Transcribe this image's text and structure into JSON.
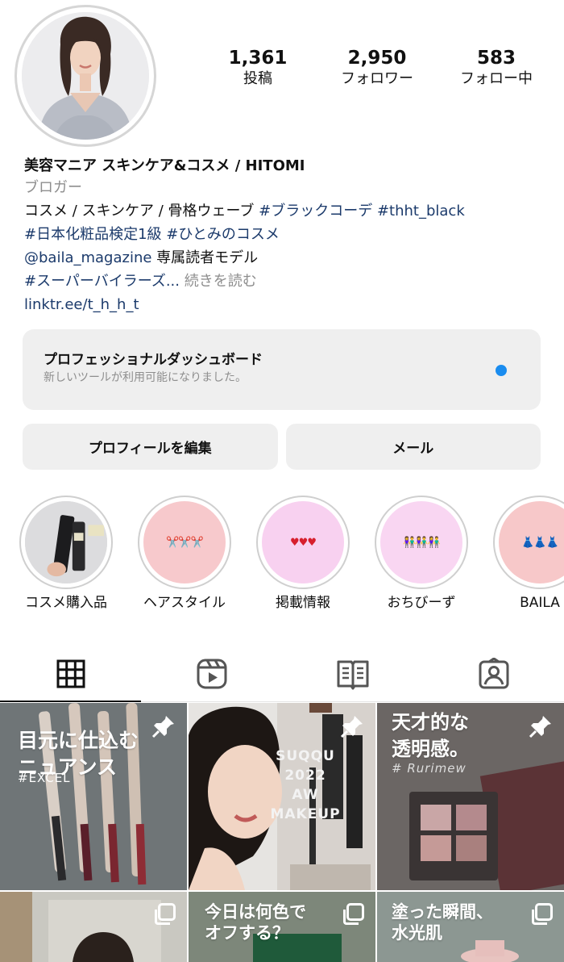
{
  "profile": {
    "stats": [
      {
        "value": "1,361",
        "label": "投稿"
      },
      {
        "value": "2,950",
        "label": "フォロワー"
      },
      {
        "value": "583",
        "label": "フォロー中"
      }
    ],
    "name": "美容マニア スキンケア&コスメ / HITOMI",
    "category": "ブロガー",
    "bio": {
      "line1_text": "コスメ / スキンケア / 骨格ウェーブ ",
      "line1_tag1": "#ブラックコーデ",
      "line1_tag2": "#thht_black",
      "line2_tag1": "#日本化粧品検定1級",
      "line2_tag2": "#ひとみのコスメ",
      "line3_mention": "@baila_magazine",
      "line3_text": " 専属読者モデル",
      "line4_tag": "#スーパーバイラーズ...",
      "line4_more": "続きを読む",
      "link": "linktr.ee/t_h_h_t"
    }
  },
  "dashboard": {
    "title": "プロフェッショナルダッシュボード",
    "subtitle": "新しいツールが利用可能になりました。",
    "dot_color": "#1a8cef"
  },
  "buttons": {
    "edit_profile": "プロフィールを編集",
    "email": "メール"
  },
  "highlights": [
    {
      "label": "コスメ購入品",
      "icon": "cosmetics-photo"
    },
    {
      "label": "ヘアスタイル",
      "icon": "scissors-emoji"
    },
    {
      "label": "掲載情報",
      "icon": "hearts-emoji"
    },
    {
      "label": "おちびーず",
      "icon": "people-emoji"
    },
    {
      "label": "BAILA",
      "icon": "dress-emoji"
    }
  ],
  "tabs": [
    "grid-icon",
    "reels-icon",
    "guides-icon",
    "tagged-icon"
  ],
  "posts": [
    {
      "text": "目元に仕込む\nニュアンス",
      "sub": "#EXCEL",
      "badge": "pin-icon"
    },
    {
      "text": "",
      "sub": "SUQQU 2022 AW MAKEUP",
      "badge": "pin-icon"
    },
    {
      "text": "天才的な\n透明感。",
      "sub": "# Rurimew",
      "badge": "pin-icon"
    },
    {
      "text": "",
      "sub": "",
      "badge": "carousel-icon"
    },
    {
      "text": "今日は何色で\nオフする？",
      "sub": "",
      "badge": "carousel-icon"
    },
    {
      "text": "塗った瞬間、\n水光肌",
      "sub": "",
      "badge": "carousel-icon"
    }
  ]
}
